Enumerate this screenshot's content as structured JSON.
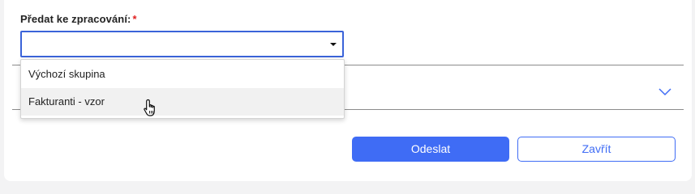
{
  "form": {
    "field_label": "Předat ke zpracování:",
    "required_mark": "*",
    "select_value": ""
  },
  "dropdown": {
    "options": [
      {
        "label": "Výchozí skupina"
      },
      {
        "label": "Fakturanti - vzor"
      }
    ],
    "hovered_index": 1
  },
  "actions": {
    "submit_label": "Odeslat",
    "close_label": "Zavřít"
  },
  "icons": {
    "select_caret": "caret-down-icon",
    "collapsed_section": "chevron-down-icon",
    "pointer": "hand-pointer-icon"
  },
  "colors": {
    "accent": "#3f6cf5",
    "focus_border": "#3b63d9",
    "required": "#e02020"
  }
}
